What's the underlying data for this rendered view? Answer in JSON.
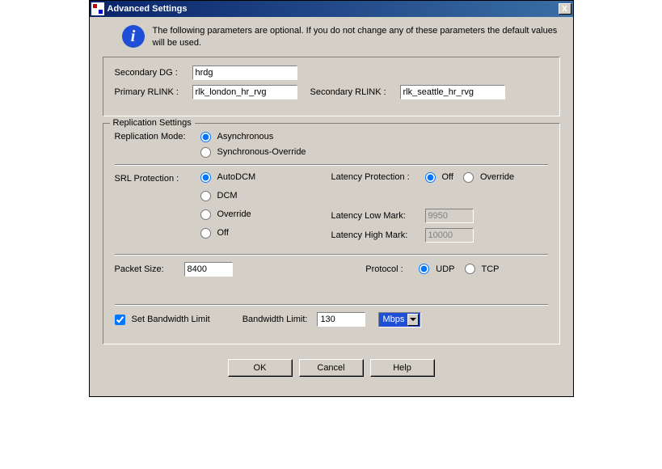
{
  "window": {
    "title": "Advanced Settings",
    "close": "X"
  },
  "info": {
    "text": "The following parameters are optional. If you do not change any of these parameters the default values will be used."
  },
  "dg": {
    "sec_dg_label": "Secondary DG :",
    "sec_dg_value": "hrdg",
    "pri_rlink_label": "Primary RLINK :",
    "pri_rlink_value": "rlk_london_hr_rvg",
    "sec_rlink_label": "Secondary RLINK :",
    "sec_rlink_value": "rlk_seattle_hr_rvg"
  },
  "rep": {
    "legend": "Replication Settings",
    "mode_label": "Replication Mode:",
    "mode_async": "Asynchronous",
    "mode_sync": "Synchronous-Override",
    "srl_label": "SRL Protection :",
    "srl_autodcm": "AutoDCM",
    "srl_dcm": "DCM",
    "srl_override": "Override",
    "srl_off": "Off",
    "lat_label": "Latency Protection :",
    "lat_off": "Off",
    "lat_override": "Override",
    "lat_low_label": "Latency Low Mark:",
    "lat_low_value": "9950",
    "lat_high_label": "Latency High Mark:",
    "lat_high_value": "10000",
    "packet_label": "Packet Size:",
    "packet_value": "8400",
    "proto_label": "Protocol :",
    "proto_udp": "UDP",
    "proto_tcp": "TCP",
    "bw_check": "Set Bandwidth Limit",
    "bw_label": "Bandwidth Limit:",
    "bw_value": "130",
    "bw_unit": "Mbps"
  },
  "buttons": {
    "ok": "OK",
    "cancel": "Cancel",
    "help": "Help"
  }
}
